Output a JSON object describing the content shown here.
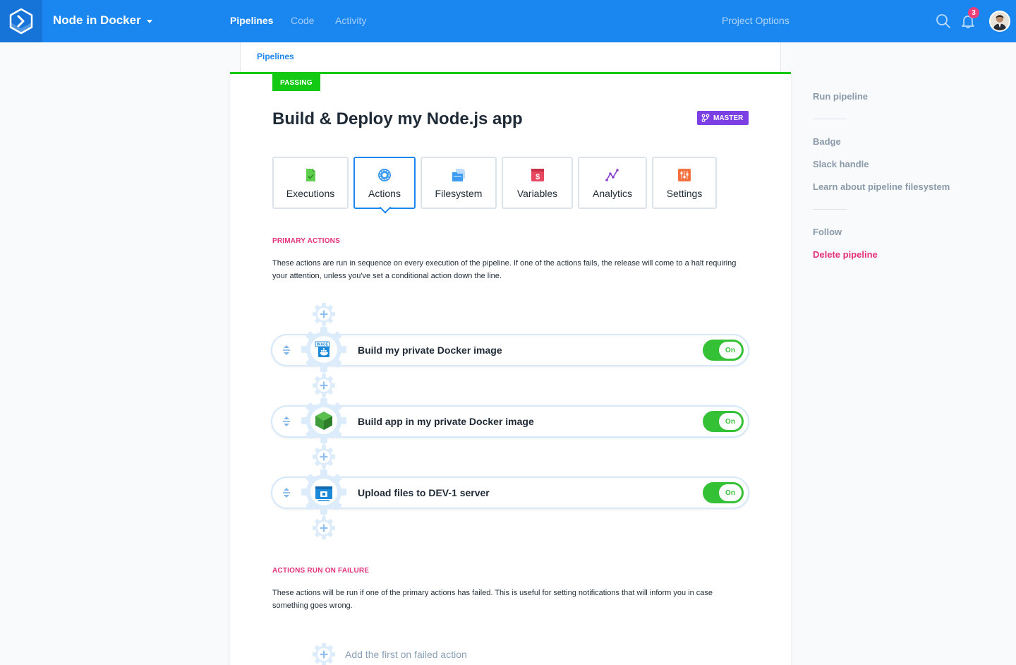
{
  "topbar": {
    "project_name": "Node in Docker",
    "nav": [
      "Pipelines",
      "Code",
      "Activity"
    ],
    "project_options": "Project Options",
    "notification_count": "3",
    "brand_color": "#1a86f0"
  },
  "breadcrumb": {
    "label": "Pipelines"
  },
  "pipeline": {
    "status": "PASSING",
    "title": "Build & Deploy my Node.js app",
    "branch": "MASTER"
  },
  "tabs": [
    {
      "label": "Executions",
      "icon": "executions-icon"
    },
    {
      "label": "Actions",
      "icon": "actions-gear-icon",
      "active": true
    },
    {
      "label": "Filesystem",
      "icon": "filesystem-icon"
    },
    {
      "label": "Variables",
      "icon": "variables-dollar-icon"
    },
    {
      "label": "Analytics",
      "icon": "analytics-chart-icon"
    },
    {
      "label": "Settings",
      "icon": "settings-sliders-icon"
    }
  ],
  "primary": {
    "title": "PRIMARY ACTIONS",
    "desc": "These actions are run in sequence on every execution of the pipeline. If one of the actions fails, the release will come to a halt requiring your attention, unless you've set a conditional action down the line."
  },
  "actions": [
    {
      "name": "Build my private Docker image",
      "icon": "docker-image-icon",
      "toggle": "On"
    },
    {
      "name": "Build app in my private Docker image",
      "icon": "nodejs-hexagon-icon",
      "toggle": "On"
    },
    {
      "name": "Upload files to DEV-1 server",
      "icon": "sftp-upload-icon",
      "toggle": "On"
    }
  ],
  "failure": {
    "title": "ACTIONS RUN ON FAILURE",
    "desc": "These actions will be run if one of the primary actions has failed. This is useful for setting notifications that will inform you in case something goes wrong.",
    "add_label": "Add the first on failed action"
  },
  "sidebar": {
    "run": "Run pipeline",
    "badge": "Badge",
    "slack": "Slack handle",
    "learn": "Learn about pipeline filesystem",
    "follow": "Follow",
    "delete": "Delete pipeline"
  },
  "colors": {
    "passing": "#14c914",
    "master_badge": "#7b3fe4",
    "section_title": "#e5317d",
    "toggle_on": "#35c135"
  }
}
